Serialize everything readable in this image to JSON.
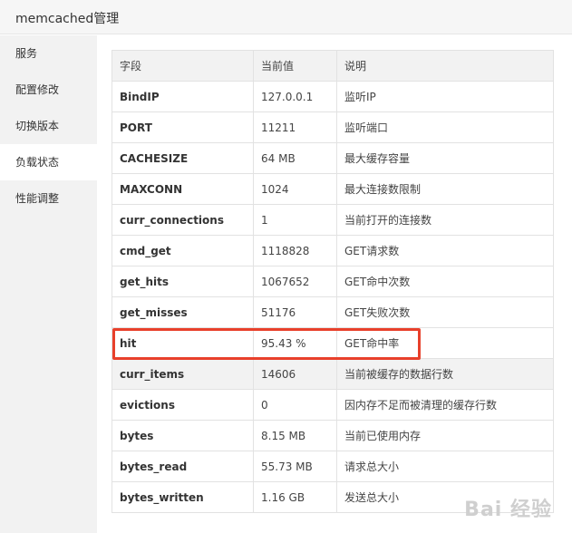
{
  "window": {
    "title": "memcached管理"
  },
  "sidebar": {
    "items": [
      {
        "label": "服务",
        "active": false
      },
      {
        "label": "配置修改",
        "active": false
      },
      {
        "label": "切换版本",
        "active": false
      },
      {
        "label": "负载状态",
        "active": true
      },
      {
        "label": "性能调整",
        "active": false
      }
    ]
  },
  "table": {
    "headers": [
      "字段",
      "当前值",
      "说明"
    ],
    "rows": [
      [
        "BindIP",
        "127.0.0.1",
        "监听IP"
      ],
      [
        "PORT",
        "11211",
        "监听端口"
      ],
      [
        "CACHESIZE",
        "64 MB",
        "最大缓存容量"
      ],
      [
        "MAXCONN",
        "1024",
        "最大连接数限制"
      ],
      [
        "curr_connections",
        "1",
        "当前打开的连接数"
      ],
      [
        "cmd_get",
        "1118828",
        "GET请求数"
      ],
      [
        "get_hits",
        "1067652",
        "GET命中次数"
      ],
      [
        "get_misses",
        "51176",
        "GET失败次数"
      ],
      [
        "hit",
        "95.43 %",
        "GET命中率"
      ],
      [
        "curr_items",
        "14606",
        "当前被缓存的数据行数"
      ],
      [
        "evictions",
        "0",
        "因内存不足而被清理的缓存行数"
      ],
      [
        "bytes",
        "8.15 MB",
        "当前已使用内存"
      ],
      [
        "bytes_read",
        "55.73 MB",
        "请求总大小"
      ],
      [
        "bytes_written",
        "1.16 GB",
        "发送总大小"
      ]
    ]
  },
  "watermark": {
    "text": "Bai 经验"
  },
  "colors": {
    "highlight": "#e8402b",
    "sidebar_bg": "#f2f2f2",
    "header_bg": "#f2f2f2"
  }
}
